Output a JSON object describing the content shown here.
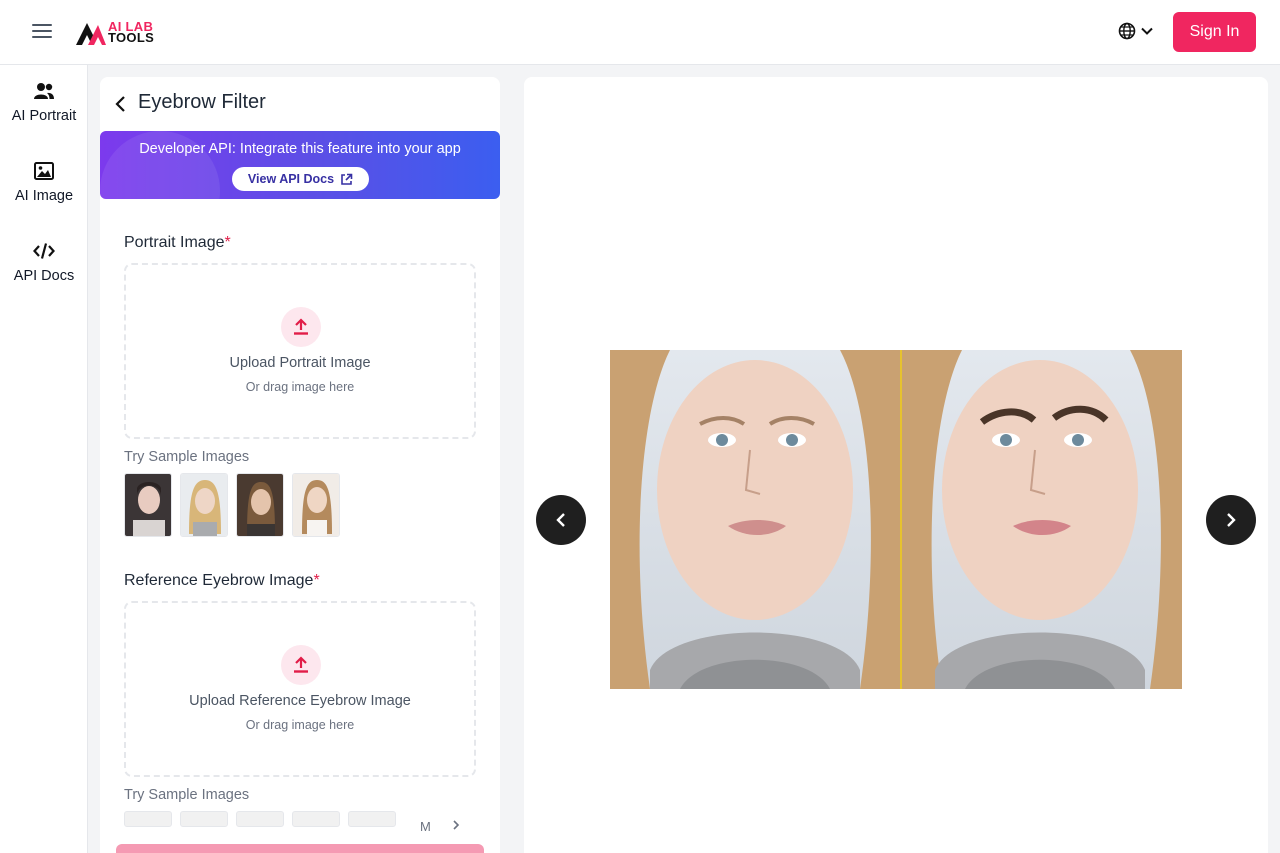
{
  "header": {
    "logo_line1": "AI LAB",
    "logo_line2": "TOOLS",
    "signin_label": "Sign In",
    "menu_icon": "menu-icon",
    "lang_icon": "globe-icon"
  },
  "sidebar": {
    "items": [
      {
        "label": "AI Portrait",
        "icon": "users-icon"
      },
      {
        "label": "AI Image",
        "icon": "image-icon"
      },
      {
        "label": "API Docs",
        "icon": "code-icon"
      }
    ]
  },
  "panel": {
    "title": "Eyebrow Filter",
    "api_banner_text": "Developer API: Integrate this feature into your app",
    "api_button_label": "View API Docs",
    "portrait": {
      "label": "Portrait Image",
      "required_mark": "*",
      "upload_title": "Upload Portrait Image",
      "upload_sub": "Or drag image here",
      "try_label": "Try Sample Images"
    },
    "reference": {
      "label": "Reference Eyebrow Image",
      "required_mark": "*",
      "upload_title": "Upload Reference Eyebrow Image",
      "upload_sub": "Or drag image here",
      "try_label": "Try Sample Images",
      "more_label": "M"
    }
  },
  "colors": {
    "brand": "#f02660",
    "banner_start": "#7c3aed",
    "banner_end": "#3b5ef0",
    "compare_divider": "#e6c22e"
  }
}
